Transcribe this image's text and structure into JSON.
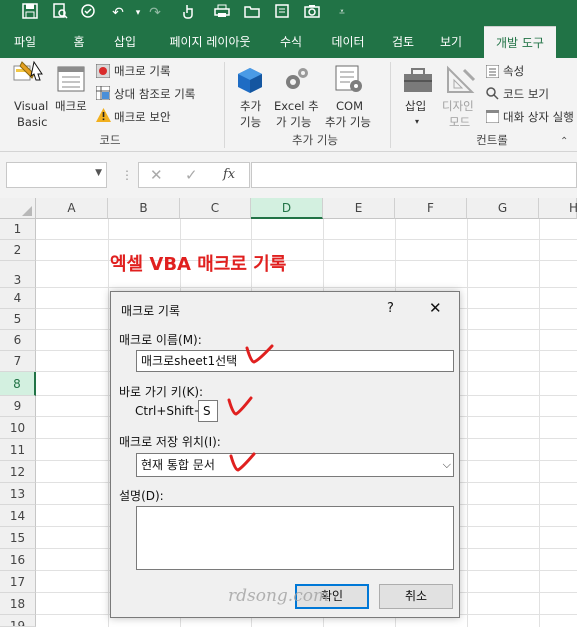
{
  "qat": {
    "icons": [
      "save-icon",
      "print-preview-icon",
      "touch-mode-icon",
      "undo-icon",
      "redo-icon",
      "touch-icon",
      "open-icon",
      "print-icon",
      "camera-icon",
      "customize-icon"
    ]
  },
  "tabs": [
    "파일",
    "홈",
    "삽입",
    "페이지 레이아웃",
    "수식",
    "데이터",
    "검토",
    "보기",
    "개발 도구"
  ],
  "ribbon": {
    "visual_basic": [
      "Visual",
      "Basic"
    ],
    "macro": "매크로",
    "record_macro": "매크로 기록",
    "relative_ref": "상대 참조로 기록",
    "macro_security": "매크로 보안",
    "group_code": "코드",
    "addins": [
      "추가",
      "기능"
    ],
    "excel_addins": [
      "Excel 추",
      "가 기능"
    ],
    "com_addins": [
      "COM",
      "추가 기능"
    ],
    "group_addins": "추가 기능",
    "insert": "삽입",
    "design_mode": [
      "디자인",
      "모드"
    ],
    "properties": "속성",
    "view_code": "코드 보기",
    "run_dialog": "대화 상자 실행",
    "group_controls": "컨트롤"
  },
  "formula_bar": {
    "name_box": "",
    "fx": "fx",
    "content": ""
  },
  "columns": [
    "A",
    "B",
    "C",
    "D",
    "E",
    "F",
    "G",
    "H"
  ],
  "rows": [
    "1",
    "2",
    "3",
    "4",
    "5",
    "6",
    "7",
    "8",
    "9",
    "10",
    "11",
    "12",
    "13",
    "14",
    "15",
    "16",
    "17",
    "18",
    "19"
  ],
  "sheet_heading": "엑셀 VBA 매크로 기록",
  "dialog": {
    "title": "매크로 기록",
    "help": "?",
    "close": "✕",
    "name_label": "매크로 이름(M):",
    "name_value": "매크로sheet1선택",
    "shortcut_label": "바로 가기 키(K):",
    "shortcut_prefix": "Ctrl+Shift+",
    "shortcut_value": "S",
    "store_label": "매크로 저장 위치(I):",
    "store_value": "현재 통합 문서",
    "desc_label": "설명(D):",
    "desc_value": "",
    "ok": "확인",
    "cancel": "취소"
  },
  "watermark": "rdsong.com",
  "colors": {
    "excel_green": "#217346",
    "heading_red": "#e0201f",
    "selected_header": "#d3f0e0",
    "default_button_border": "#0078d7"
  }
}
